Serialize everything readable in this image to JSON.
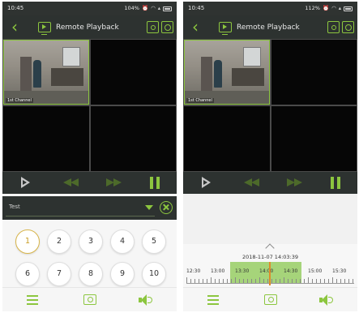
{
  "colors": {
    "accent": "#8cc63f",
    "bar_dark": "#2d3230",
    "record_fill": "#a6d47a",
    "marker": "#e08a2a"
  },
  "left": {
    "status": {
      "time": "10:45",
      "battery": "104%"
    },
    "title": "Remote Playback",
    "camera_label": "1st Channel",
    "channel_text": "Test",
    "keypad": [
      "1",
      "2",
      "3",
      "4",
      "5",
      "6",
      "7",
      "8",
      "9",
      "10"
    ],
    "selected_key": "1"
  },
  "right": {
    "status": {
      "time": "10:45",
      "battery": "112%"
    },
    "title": "Remote Playback",
    "camera_label": "1st Channel",
    "timeline": {
      "datetime": "2018-11-07 14:03:39",
      "labels": [
        "12:30",
        "13:00",
        "13:30",
        "14:00",
        "14:30",
        "15:00",
        "15:30"
      ]
    }
  },
  "icons": {
    "back": "back-arrow-icon",
    "title": "playback-screen-icon",
    "record": "record-icon",
    "snapshot": "snapshot-icon",
    "play": "play-icon",
    "rewind": "rewind-icon",
    "fast_forward": "fast-forward-icon",
    "pause": "pause-icon",
    "dropdown": "chevron-down-icon",
    "close": "close-icon",
    "menu": "menu-icon",
    "camera": "camera-icon",
    "speaker": "speaker-icon"
  }
}
